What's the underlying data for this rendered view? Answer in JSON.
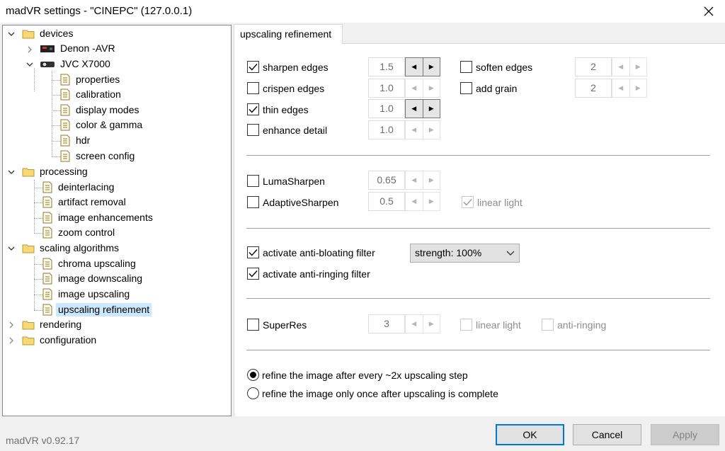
{
  "window": {
    "title": "madVR settings - \"CINEPC\" (127.0.0.1)"
  },
  "tree": {
    "devices": "devices",
    "denon": "Denon -AVR",
    "jvc": "JVC X7000",
    "properties": "properties",
    "calibration": "calibration",
    "display_modes": "display modes",
    "color_gamma": "color & gamma",
    "hdr": "hdr",
    "screen_config": "screen config",
    "processing": "processing",
    "deinterlacing": "deinterlacing",
    "artifact_removal": "artifact removal",
    "image_enhancements": "image enhancements",
    "zoom_control": "zoom control",
    "scaling_algorithms": "scaling algorithms",
    "chroma_upscaling": "chroma upscaling",
    "image_downscaling": "image downscaling",
    "image_upscaling": "image upscaling",
    "upscaling_refinement": "upscaling refinement",
    "rendering": "rendering",
    "configuration": "configuration"
  },
  "tab": {
    "label": "upscaling refinement"
  },
  "refine": {
    "sharpen_edges": {
      "label": "sharpen edges",
      "value": "1.5",
      "checked": true
    },
    "crispen_edges": {
      "label": "crispen edges",
      "value": "1.0",
      "checked": false
    },
    "thin_edges": {
      "label": "thin edges",
      "value": "1.0",
      "checked": true
    },
    "enhance_detail": {
      "label": "enhance detail",
      "value": "1.0",
      "checked": false
    },
    "soften_edges": {
      "label": "soften edges",
      "value": "2",
      "checked": false
    },
    "add_grain": {
      "label": "add grain",
      "value": "2",
      "checked": false
    }
  },
  "sharpen": {
    "luma": {
      "label": "LumaSharpen",
      "value": "0.65",
      "checked": false
    },
    "adaptive": {
      "label": "AdaptiveSharpen",
      "value": "0.5",
      "checked": false
    },
    "adaptive_linear": {
      "label": "linear light",
      "checked": true
    }
  },
  "antibloat": {
    "bloating": {
      "label": "activate anti-bloating filter",
      "checked": true
    },
    "ringing": {
      "label": "activate anti-ringing filter",
      "checked": true
    },
    "strength": "strength: 100%"
  },
  "superres": {
    "label": "SuperRes",
    "value": "3",
    "checked": false,
    "linear": "linear light",
    "antiring": "anti-ringing"
  },
  "refine_mode": {
    "every": "refine the image after every ~2x upscaling step",
    "once": "refine the image only once after upscaling is complete",
    "selected": "every"
  },
  "footer": {
    "version": "madVR v0.92.17"
  },
  "buttons": {
    "ok": "OK",
    "cancel": "Cancel",
    "apply": "Apply"
  }
}
